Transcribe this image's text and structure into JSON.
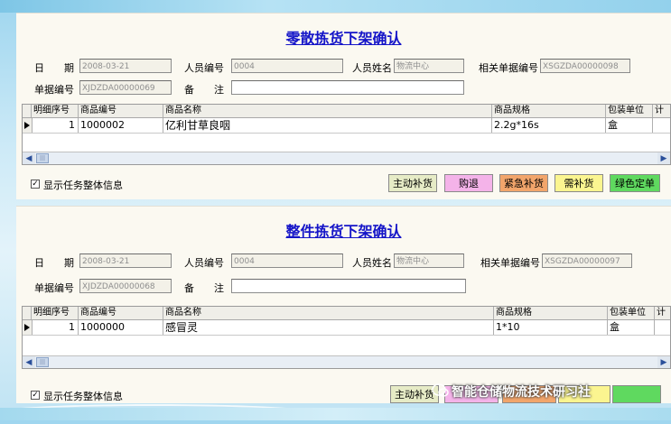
{
  "panels": [
    {
      "title": "零散拣货下架确认",
      "labels": {
        "date": "日　　期",
        "staff_id": "人员编号",
        "staff_name": "人员姓名",
        "related_no": "相关单据编号",
        "doc_no": "单据编号",
        "remark": "备　　注"
      },
      "values": {
        "date": "2008-03-21",
        "staff_id": "0004",
        "staff_name": "物流中心",
        "related_no": "XSGZDA00000098",
        "doc_no": "XJDZDA00000069",
        "remark": ""
      },
      "columns": [
        "明细序号",
        "商品编号",
        "商品名称",
        "商品规格",
        "包装单位",
        "计"
      ],
      "rows": [
        [
          "1",
          "1000002",
          "亿利甘草良咽",
          "2.2g*16s",
          "盒",
          ""
        ]
      ],
      "show_task_info": "显示任务整体信息",
      "buttons": [
        "主动补货",
        "购退",
        "紧急补货",
        "需补货",
        "绿色定单"
      ]
    },
    {
      "title": "整件拣货下架确认",
      "labels": {
        "date": "日　　期",
        "staff_id": "人员编号",
        "staff_name": "人员姓名",
        "related_no": "相关单据编号",
        "doc_no": "单据编号",
        "remark": "备　　注"
      },
      "values": {
        "date": "2008-03-21",
        "staff_id": "0004",
        "staff_name": "物流中心",
        "related_no": "XSGZDA00000097",
        "doc_no": "XJDZDA00000068",
        "remark": ""
      },
      "columns": [
        "明细序号",
        "商品编号",
        "商品名称",
        "商品规格",
        "包装单位",
        "计"
      ],
      "rows": [
        [
          "1",
          "1000000",
          "感冒灵",
          "1*10",
          "盒",
          ""
        ]
      ],
      "show_task_info": "显示任务整体信息",
      "buttons": [
        "主动补货"
      ]
    }
  ],
  "watermark": "智能仓储物流技术研习社",
  "colors": {
    "title": "#1515c8",
    "btn_yellow_green": "#e6ebc6",
    "btn_pink": "#f4b3e9",
    "btn_orange": "#f2a56b",
    "btn_yellow": "#fbf590",
    "btn_green": "#5fd95f"
  }
}
